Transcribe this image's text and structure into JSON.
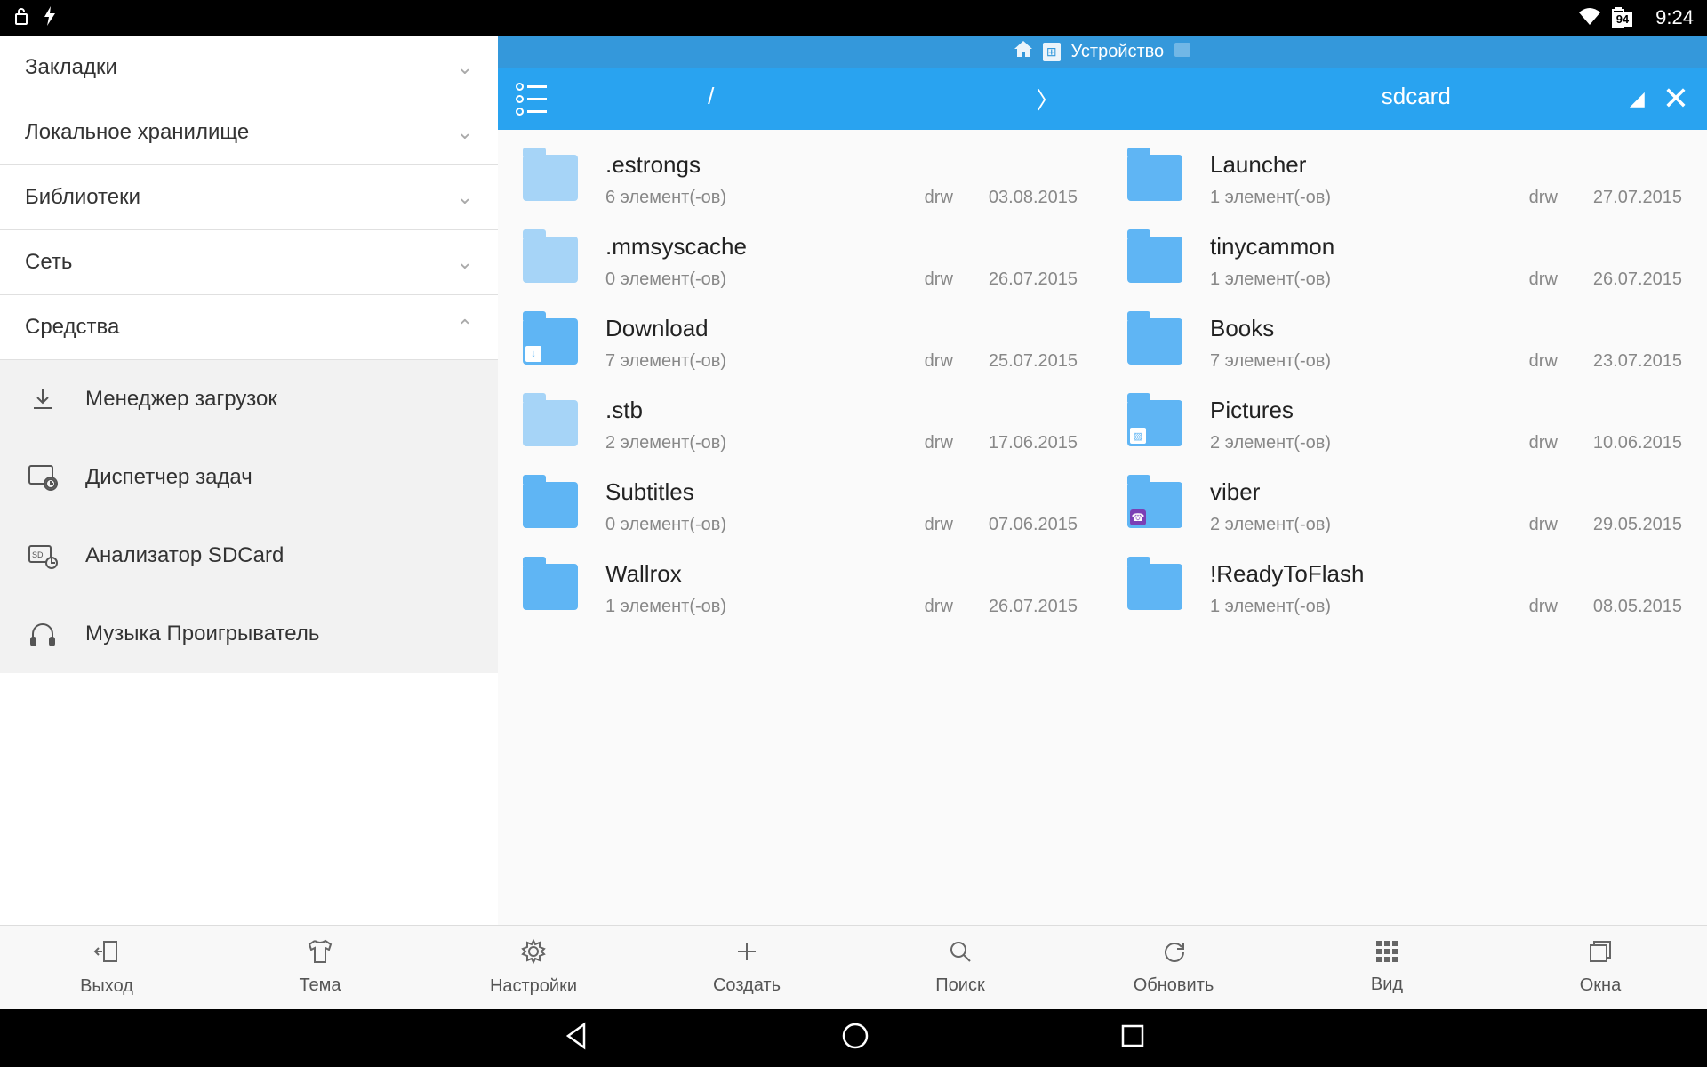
{
  "status": {
    "time": "9:24",
    "battery": "94"
  },
  "sidebar": {
    "sections": [
      {
        "label": "Закладки"
      },
      {
        "label": "Локальное хранилище"
      },
      {
        "label": "Библиотеки"
      },
      {
        "label": "Сеть"
      },
      {
        "label": "Средства"
      }
    ],
    "tools": [
      {
        "label": "Менеджер загрузок"
      },
      {
        "label": "Диспетчер задач"
      },
      {
        "label": "Анализатор SDCard"
      },
      {
        "label": "Музыка Проигрыватель"
      }
    ]
  },
  "header": {
    "tab_label": "Устройство",
    "path": {
      "root": "/",
      "sep": "〉",
      "current": "sdcard"
    }
  },
  "files_left": [
    {
      "name": ".estrongs",
      "count": "6 элемент(-ов)",
      "perm": "drw",
      "date": "03.08.2015",
      "light": true
    },
    {
      "name": ".mmsyscache",
      "count": "0 элемент(-ов)",
      "perm": "drw",
      "date": "26.07.2015",
      "light": true
    },
    {
      "name": "Download",
      "count": "7 элемент(-ов)",
      "perm": "drw",
      "date": "25.07.2015",
      "overlay": "↓"
    },
    {
      "name": ".stb",
      "count": "2 элемент(-ов)",
      "perm": "drw",
      "date": "17.06.2015",
      "light": true
    },
    {
      "name": "Subtitles",
      "count": "0 элемент(-ов)",
      "perm": "drw",
      "date": "07.06.2015"
    },
    {
      "name": "Wallrox",
      "count": "1 элемент(-ов)",
      "perm": "drw",
      "date": "26.07.2015"
    }
  ],
  "files_right": [
    {
      "name": "Launcher",
      "count": "1 элемент(-ов)",
      "perm": "drw",
      "date": "27.07.2015"
    },
    {
      "name": "tinycammon",
      "count": "1 элемент(-ов)",
      "perm": "drw",
      "date": "26.07.2015"
    },
    {
      "name": "Books",
      "count": "7 элемент(-ов)",
      "perm": "drw",
      "date": "23.07.2015"
    },
    {
      "name": "Pictures",
      "count": "2 элемент(-ов)",
      "perm": "drw",
      "date": "10.06.2015",
      "overlay": "▨"
    },
    {
      "name": "viber",
      "count": "2 элемент(-ов)",
      "perm": "drw",
      "date": "29.05.2015",
      "overlay_purple": "☎"
    },
    {
      "name": "!ReadyToFlash",
      "count": "1 элемент(-ов)",
      "perm": "drw",
      "date": "08.05.2015"
    }
  ],
  "toolbar": [
    {
      "label": "Выход"
    },
    {
      "label": "Тема"
    },
    {
      "label": "Настройки"
    },
    {
      "label": "Создать"
    },
    {
      "label": "Поиск"
    },
    {
      "label": "Обновить"
    },
    {
      "label": "Вид"
    },
    {
      "label": "Окна"
    }
  ]
}
